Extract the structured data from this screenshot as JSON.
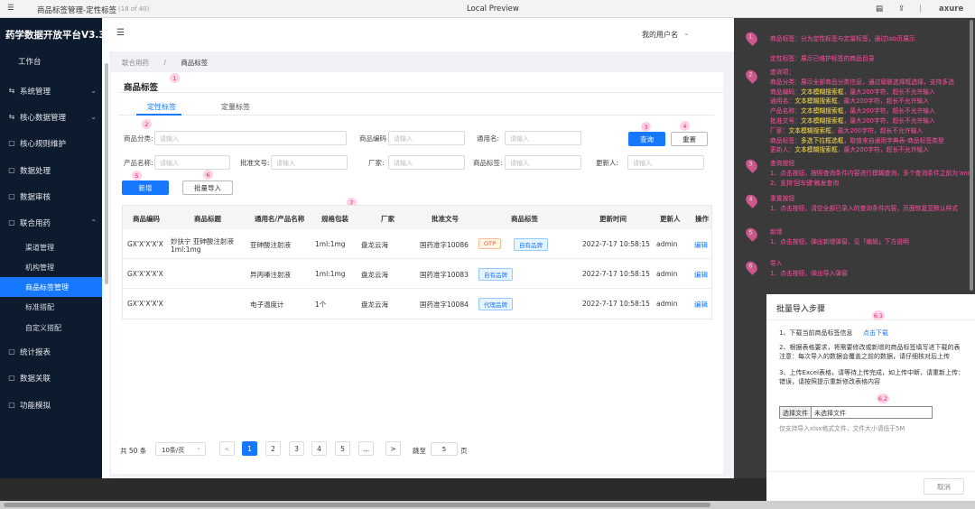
{
  "browser": {
    "title": "商品标签管理-定性标签",
    "page_count": "(18 of 40)",
    "center": "Local Preview",
    "brand": "axure"
  },
  "sidebar": {
    "app_title": "药学数据开放平台V3.3",
    "items": [
      {
        "label": "工作台",
        "icon": ""
      },
      {
        "label": "系统管理",
        "icon": "⇆"
      },
      {
        "label": "核心数据管理",
        "icon": "⇆"
      },
      {
        "label": "核心规则维护",
        "icon": "▢"
      },
      {
        "label": "数据处理",
        "icon": "▢"
      },
      {
        "label": "数据审核",
        "icon": "▢"
      },
      {
        "label": "联合用药",
        "icon": "▢"
      }
    ],
    "sub_items": [
      "渠道管理",
      "机构管理",
      "商品标签管理",
      "标准搭配",
      "自定义搭配"
    ],
    "items2": [
      {
        "label": "统计报表",
        "icon": "▢"
      },
      {
        "label": "数据关联",
        "icon": "▢"
      },
      {
        "label": "功能模拟",
        "icon": "▢"
      }
    ]
  },
  "header": {
    "user": "我的用户名"
  },
  "breadcrumb": {
    "first": "联合用药",
    "sep": "/",
    "second": "商品标签"
  },
  "card": {
    "title": "商品标签",
    "tabs": [
      "定性标签",
      "定量标签"
    ]
  },
  "filters": {
    "category": "商品分类:",
    "code": "商品编码",
    "generic": "通用名:",
    "product": "产品名称:",
    "approval": "批准文号:",
    "maker": "厂家:",
    "tag": "商品标签:",
    "updater": "更新人:",
    "placeholder": "请输入"
  },
  "buttons": {
    "query": "查询",
    "reset": "重置",
    "add": "新增",
    "import": "批量导入"
  },
  "table": {
    "headers": [
      "商品编码",
      "商品标题",
      "通用名/产品名称",
      "规格包装",
      "厂家",
      "批准文号",
      "商品标签",
      "更新时间",
      "更新人",
      "操作"
    ],
    "rows": [
      {
        "code": "GX'X'X'X'X",
        "title1": "妙扶宁 亚砷酸注射液",
        "title2": "1ml:1mg",
        "generic": "亚砷酸注射液",
        "spec": "1ml:1mg",
        "maker": "盘龙云海",
        "approval": "国药准字10086",
        "tags": [
          "OTP",
          "自有品牌"
        ],
        "time": "2022-7-17 10:58:15",
        "user": "admin",
        "op": "编辑"
      },
      {
        "code": "GX'X'X'X'X",
        "title1": "",
        "title2": "",
        "generic": "异丙嗪注射液",
        "spec": "1ml:1mg",
        "maker": "盘龙云海",
        "approval": "国药准字10083",
        "tags": [
          "自有品牌"
        ],
        "time": "2022-7-17 10:58:15",
        "user": "admin",
        "op": "编辑"
      },
      {
        "code": "GX'X'X'X'X",
        "title1": "",
        "title2": "",
        "generic": "电子温度计",
        "spec": "1个",
        "maker": "盘龙云海",
        "approval": "国药准字10084",
        "tags": [
          "代理品牌"
        ],
        "time": "2022-7-17 10:58:15",
        "user": "admin",
        "op": "编辑"
      }
    ]
  },
  "pagination": {
    "total": "共 50 条",
    "size": "10条/页",
    "prev": "<",
    "pages": [
      "1",
      "2",
      "3",
      "4",
      "5",
      "..."
    ],
    "next": ">",
    "goto": "跳至",
    "goto_val": "5",
    "page": "页"
  },
  "pins": [
    "1",
    "2",
    "3",
    "4",
    "5",
    "6",
    "7"
  ],
  "notes": {
    "n1": [
      "商品标签：分为定性标签与定量标签，通过tab页展示",
      "",
      "定性标签：展示已维护标签的商品目录"
    ],
    "n2": [
      "查询项：",
      "商品分类：展示全部商品分类信息，通过级联选择框选择，支持多选",
      "商品编码：文本模糊搜索框，最大200字符，超长不允许输入",
      "通用名：文本模糊搜索框，最大200字符，超长不允许输入",
      "产品名称：文本模糊搜索框，最大200字符，超长不允许输入",
      "批准文号：文本模糊搜索框，最大200字符，超长不允许输入",
      "厂家：文本模糊搜索框，最大200字符，超长不允许输入",
      "商品标签：多选下拉框选框，取值来自通用字典表-商品标签类型",
      "更新人：文本模糊搜索框，最大200字符，超长不允许输入"
    ],
    "n3": [
      "查询按钮",
      "1、点击按钮，按照查询条件内容进行模糊查询，多个查询条件之前为'and'",
      "2、支持'回车键'触发查询"
    ],
    "n4": [
      "重置按钮",
      "1、点击按钮，清空全部已录入的查询条件内容，页面恢复至默认样式"
    ],
    "n5": [
      "新增",
      "1、点击按钮，弹出新增弹窗，见「编辑」下方说明"
    ],
    "n6": [
      "导入",
      "1、点击按钮，弹出导入弹窗"
    ]
  },
  "modal": {
    "title": "批量导入步骤",
    "step1": "1、下载当前商品标签信息",
    "download": "点击下载",
    "step2a": "2、根据表格要求，将需要修改或新增的商品标签填写进下载的表",
    "step2b": "注意：每次导入的数据会覆盖之前的数据，请仔细核对后上传",
    "step3a": "3、上传Excel表格，请等待上传完成，如上传中断，请重新上传：",
    "step3b": "错误，请按照提示重新修改表格内容",
    "choose": "选择文件",
    "none": "未选择文件",
    "hint": "仅支持导入xlsx格式文件，文件大小请低于5M",
    "cancel": "取消",
    "pin1": "6.1",
    "pin2": "6.2"
  }
}
